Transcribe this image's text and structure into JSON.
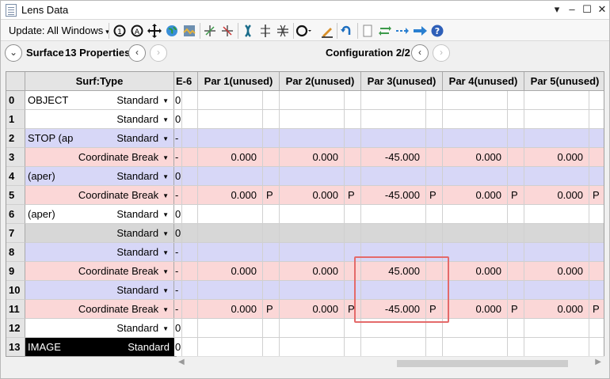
{
  "window": {
    "title": "Lens Data"
  },
  "toolbar": {
    "update_label": "Update: All Windows",
    "icons": [
      "gear-cycle-icon",
      "cycle-a-icon",
      "move-icon",
      "globe-icon",
      "map-icon",
      "cross-pos-icon",
      "cross-neg-icon",
      "lens-icon",
      "optic-left-icon",
      "optic-right-icon",
      "circle-icon",
      "pencil-icon",
      "undo-icon",
      "page-icon",
      "swap-icon",
      "dots-arrow-icon",
      "arrow-right-icon",
      "help-icon"
    ]
  },
  "navbar": {
    "surface_label": "Surface",
    "properties_label": "13 Properties",
    "config_label": "Configuration 2/2"
  },
  "columns": [
    "Surf:Type",
    "E-6",
    "Par 1(unused)",
    "Par 2(unused)",
    "Par 3(unused)",
    "Par 4(unused)",
    "Par 5(unused)"
  ],
  "rows": [
    {
      "num": "0",
      "comment": "OBJECT",
      "type": "Standard",
      "e6": "0",
      "style": "white",
      "params": [
        "",
        "",
        "",
        "",
        ""
      ],
      "flags": [
        "",
        "",
        "",
        "",
        ""
      ]
    },
    {
      "num": "1",
      "comment": "",
      "type": "Standard",
      "e6": "0",
      "style": "white",
      "params": [
        "",
        "",
        "",
        "",
        ""
      ],
      "flags": [
        "",
        "",
        "",
        "",
        ""
      ]
    },
    {
      "num": "2",
      "comment": "STOP (ap",
      "type": "Standard",
      "e6": "-",
      "style": "blue",
      "params": [
        "",
        "",
        "",
        "",
        ""
      ],
      "flags": [
        "",
        "",
        "",
        "",
        ""
      ]
    },
    {
      "num": "3",
      "comment": "",
      "type": "Coordinate Break",
      "e6": "-",
      "style": "pink",
      "params": [
        "0.000",
        "0.000",
        "-45.000",
        "0.000",
        "0.000"
      ],
      "flags": [
        "",
        "",
        "",
        "",
        ""
      ]
    },
    {
      "num": "4",
      "comment": "(aper)",
      "type": "Standard",
      "e6": "0",
      "style": "blue",
      "params": [
        "",
        "",
        "",
        "",
        ""
      ],
      "flags": [
        "",
        "",
        "",
        "",
        ""
      ]
    },
    {
      "num": "5",
      "comment": "",
      "type": "Coordinate Break",
      "e6": "-",
      "style": "pink",
      "params": [
        "0.000",
        "0.000",
        "-45.000",
        "0.000",
        "0.000"
      ],
      "flags": [
        "P",
        "P",
        "P",
        "P",
        "P"
      ]
    },
    {
      "num": "6",
      "comment": "(aper)",
      "type": "Standard",
      "e6": "0",
      "style": "white",
      "params": [
        "",
        "",
        "",
        "",
        ""
      ],
      "flags": [
        "",
        "",
        "",
        "",
        ""
      ]
    },
    {
      "num": "7",
      "comment": "",
      "type": "Standard",
      "e6": "0",
      "style": "gray",
      "params": [
        "",
        "",
        "",
        "",
        ""
      ],
      "flags": [
        "",
        "",
        "",
        "",
        ""
      ]
    },
    {
      "num": "8",
      "comment": "",
      "type": "Standard",
      "e6": "-",
      "style": "blue",
      "params": [
        "",
        "",
        "",
        "",
        ""
      ],
      "flags": [
        "",
        "",
        "",
        "",
        ""
      ]
    },
    {
      "num": "9",
      "comment": "",
      "type": "Coordinate Break",
      "e6": "-",
      "style": "pink",
      "params": [
        "0.000",
        "0.000",
        "45.000",
        "0.000",
        "0.000"
      ],
      "flags": [
        "",
        "",
        "",
        "",
        ""
      ]
    },
    {
      "num": "10",
      "comment": "",
      "type": "Standard",
      "e6": "-",
      "style": "blue",
      "params": [
        "",
        "",
        "",
        "",
        ""
      ],
      "flags": [
        "",
        "",
        "",
        "",
        ""
      ]
    },
    {
      "num": "11",
      "comment": "",
      "type": "Coordinate Break",
      "e6": "-",
      "style": "pink",
      "params": [
        "0.000",
        "0.000",
        "-45.000",
        "0.000",
        "0.000"
      ],
      "flags": [
        "P",
        "P",
        "P",
        "P",
        "P"
      ]
    },
    {
      "num": "12",
      "comment": "",
      "type": "Standard",
      "e6": "0",
      "style": "white",
      "params": [
        "",
        "",
        "",
        "",
        ""
      ],
      "flags": [
        "",
        "",
        "",
        "",
        ""
      ]
    },
    {
      "num": "13",
      "comment": "IMAGE",
      "type": "Standard",
      "e6": "0",
      "style": "white",
      "params": [
        "",
        "",
        "",
        "",
        ""
      ],
      "flags": [
        "",
        "",
        "",
        "",
        ""
      ]
    }
  ],
  "colors": {
    "blue_row": "#d7d7f7",
    "pink_row": "#fbd7d7",
    "gray_row": "#d7d7d7",
    "highlight": "#e46a6a"
  }
}
